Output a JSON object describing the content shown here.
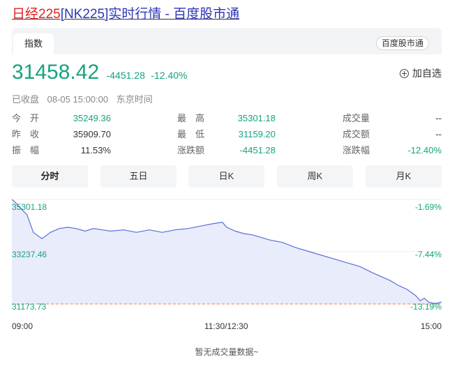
{
  "page": {
    "title_prefix": "日经225",
    "title_rest": "[NK225]实时行情 - 百度股市通"
  },
  "tabs": {
    "active_tab": "指数",
    "source_badge": "百度股市通"
  },
  "quote": {
    "price": "31458.42",
    "change": "-4451.28",
    "change_pct": "-12.40%",
    "add_watchlist": "加自选",
    "status": "已收盘",
    "datetime": "08-05 15:00:00",
    "timezone": "东京时间"
  },
  "stats": {
    "open_label": "今　开",
    "open": "35249.36",
    "high_label": "最　高",
    "high": "35301.18",
    "volume_label": "成交量",
    "volume": "--",
    "prev_close_label": "昨　收",
    "prev_close": "35909.70",
    "low_label": "最　低",
    "low": "31159.20",
    "turnover_label": "成交额",
    "turnover": "--",
    "amplitude_label": "振　幅",
    "amplitude": "11.53%",
    "change_amt_label": "涨跌额",
    "change_amt": "-4451.28",
    "change_pct_label": "涨跌幅",
    "change_pct": "-12.40%"
  },
  "period_tabs": [
    "分时",
    "五日",
    "日K",
    "周K",
    "月K"
  ],
  "chart_data": {
    "type": "area",
    "y_left_ticks": [
      "35301.18",
      "33237.46",
      "31173.73"
    ],
    "y_right_ticks": [
      "-1.69%",
      "-7.44%",
      "-13.19%"
    ],
    "x_ticks": [
      "09:00",
      "11:30/12:30",
      "15:00"
    ],
    "ylim": [
      31173.73,
      35301.18
    ],
    "reference_level": 31173.73,
    "x": [
      0,
      0.01,
      0.02,
      0.035,
      0.05,
      0.07,
      0.09,
      0.11,
      0.13,
      0.15,
      0.17,
      0.19,
      0.21,
      0.23,
      0.26,
      0.29,
      0.32,
      0.35,
      0.38,
      0.41,
      0.44,
      0.47,
      0.49,
      0.5,
      0.52,
      0.54,
      0.56,
      0.58,
      0.6,
      0.63,
      0.66,
      0.69,
      0.72,
      0.75,
      0.78,
      0.81,
      0.84,
      0.86,
      0.88,
      0.9,
      0.92,
      0.94,
      0.95,
      0.96,
      0.97,
      0.98,
      0.99,
      1.0
    ],
    "values": [
      35301,
      35150,
      34950,
      34700,
      34000,
      33750,
      34000,
      34150,
      34200,
      34150,
      34050,
      34150,
      34100,
      34050,
      34100,
      34000,
      34100,
      34000,
      34100,
      34150,
      34250,
      34350,
      34400,
      34200,
      34050,
      33950,
      33900,
      33800,
      33700,
      33600,
      33400,
      33250,
      33100,
      32950,
      32800,
      32650,
      32400,
      32250,
      32100,
      31900,
      31750,
      31500,
      31300,
      31400,
      31250,
      31200,
      31200,
      31250
    ],
    "footer_note": "暂无成交量数据~",
    "line_color": "#5b6fd6",
    "fill_color": "#e9ecfa",
    "ref_color": "#e8823a"
  }
}
